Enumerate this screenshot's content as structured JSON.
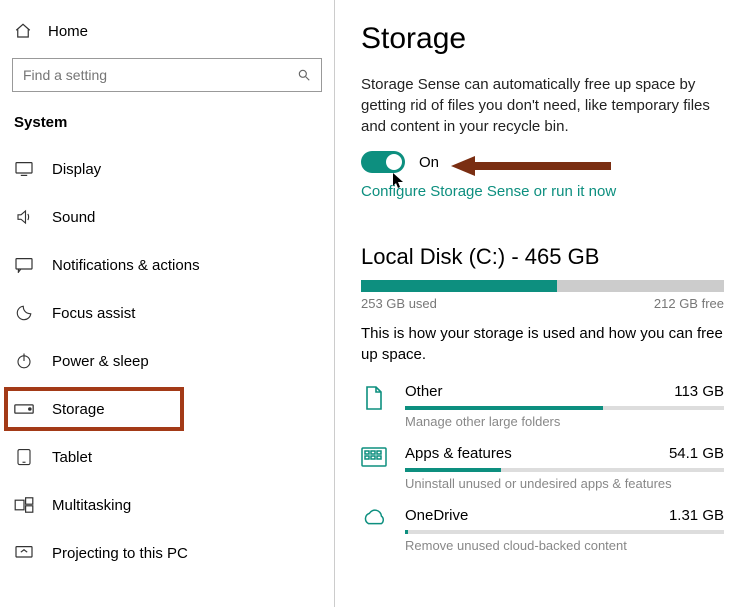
{
  "sidebar": {
    "home": "Home",
    "search_placeholder": "Find a setting",
    "section": "System",
    "items": [
      {
        "label": "Display"
      },
      {
        "label": "Sound"
      },
      {
        "label": "Notifications & actions"
      },
      {
        "label": "Focus assist"
      },
      {
        "label": "Power & sleep"
      },
      {
        "label": "Storage"
      },
      {
        "label": "Tablet"
      },
      {
        "label": "Multitasking"
      },
      {
        "label": "Projecting to this PC"
      }
    ]
  },
  "main": {
    "title": "Storage",
    "sense_desc": "Storage Sense can automatically free up space by getting rid of files you don't need, like temporary files and content in your recycle bin.",
    "toggle_label": "On",
    "config_link": "Configure Storage Sense or run it now",
    "disk": {
      "title": "Local Disk (C:) - 465 GB",
      "used_label": "253 GB used",
      "free_label": "212 GB free",
      "used_pct": 54,
      "desc": "This is how your storage is used and how you can free up space."
    },
    "categories": [
      {
        "name": "Other",
        "size": "113 GB",
        "sub": "Manage other large folders",
        "pct": 62
      },
      {
        "name": "Apps & features",
        "size": "54.1 GB",
        "sub": "Uninstall unused or undesired apps & features",
        "pct": 30
      },
      {
        "name": "OneDrive",
        "size": "1.31 GB",
        "sub": "Remove unused cloud-backed content",
        "pct": 1
      }
    ]
  }
}
